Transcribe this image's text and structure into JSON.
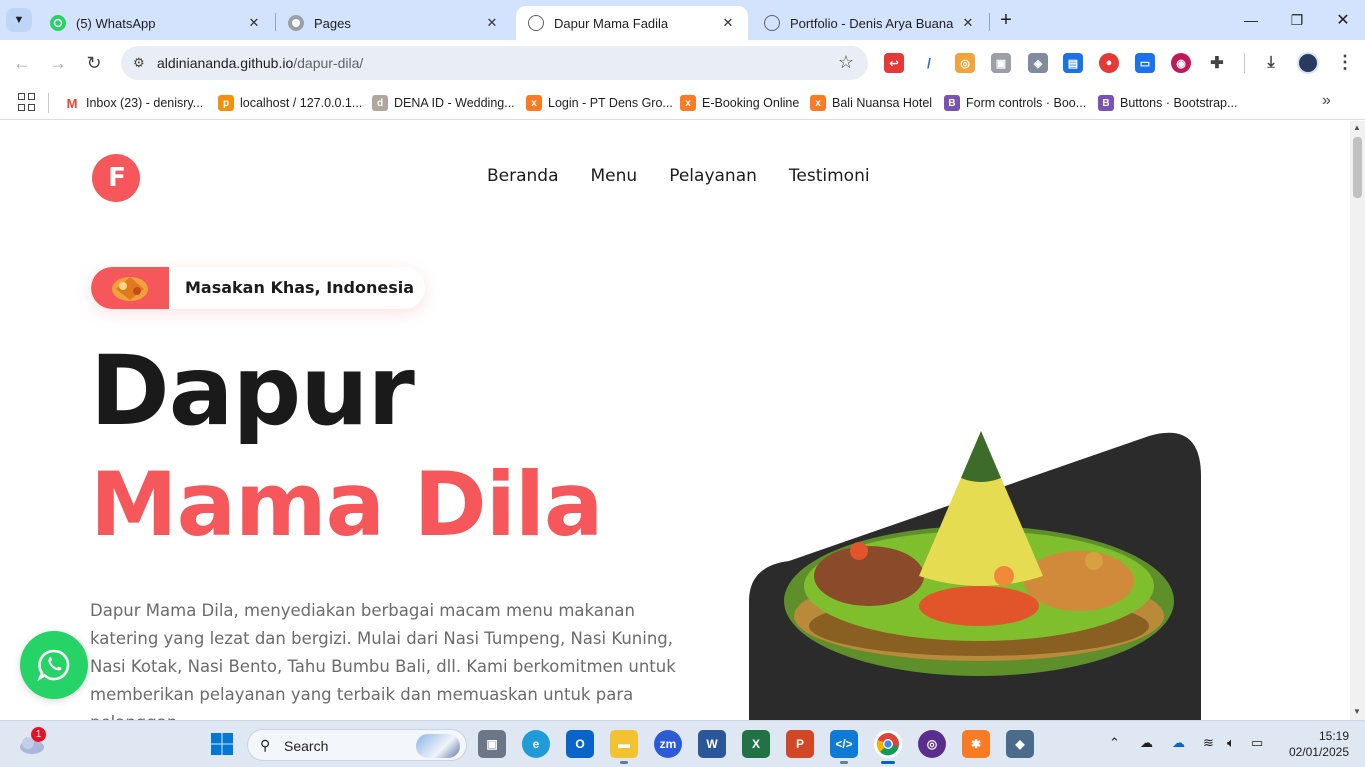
{
  "browser": {
    "tabs": [
      {
        "title": "(5) WhatsApp",
        "icon": "whatsapp-icon",
        "active": false
      },
      {
        "title": "Pages",
        "icon": "github-icon",
        "active": false
      },
      {
        "title": "Dapur Mama Fadila",
        "icon": "globe-icon",
        "active": true
      },
      {
        "title": "Portfolio - Denis Arya Buana",
        "icon": "globe-icon",
        "active": false
      }
    ],
    "url_host": "aldiniananda.github.io",
    "url_path": "/dapur-dila/",
    "bookmarks": [
      {
        "label": "Inbox (23) - denisry...",
        "icon": "gmail-icon"
      },
      {
        "label": "localhost / 127.0.0.1...",
        "icon": "phpmyadmin-icon"
      },
      {
        "label": "DENA ID - Wedding...",
        "icon": "dena-icon"
      },
      {
        "label": "Login - PT Dens Gro...",
        "icon": "xampp-icon"
      },
      {
        "label": "E-Booking Online",
        "icon": "xampp-icon"
      },
      {
        "label": "Bali Nuansa Hotel",
        "icon": "xampp-icon"
      },
      {
        "label": "Form controls · Boo...",
        "icon": "bootstrap-icon"
      },
      {
        "label": "Buttons · Bootstrap...",
        "icon": "bootstrap-icon"
      }
    ]
  },
  "site": {
    "logo_text": "F",
    "nav": [
      "Beranda",
      "Menu",
      "Pelayanan",
      "Testimoni"
    ],
    "badge_text": "Masakan Khas, Indonesia",
    "hero_title_line1": "Dapur",
    "hero_title_line2": "Mama Dila",
    "hero_description": "Dapur Mama Dila, menyediakan berbagai macam menu makanan katering yang lezat dan bergizi. Mulai dari Nasi Tumpeng, Nasi Kuning, Nasi Kotak, Nasi Bento, Tahu Bumbu Bali, dll. Kami berkomitmen untuk memberikan pelayanan yang terbaik dan memuaskan untuk para pelanggan.",
    "colors": {
      "accent": "#f5575a",
      "dark": "#1a1a1a",
      "text": "#6b6b6b",
      "whatsapp": "#25d366",
      "image_bg": "#2b2b2b"
    }
  },
  "taskbar": {
    "weather_badge": "1",
    "search_label": "Search",
    "time": "15:19",
    "date": "02/01/2025"
  }
}
